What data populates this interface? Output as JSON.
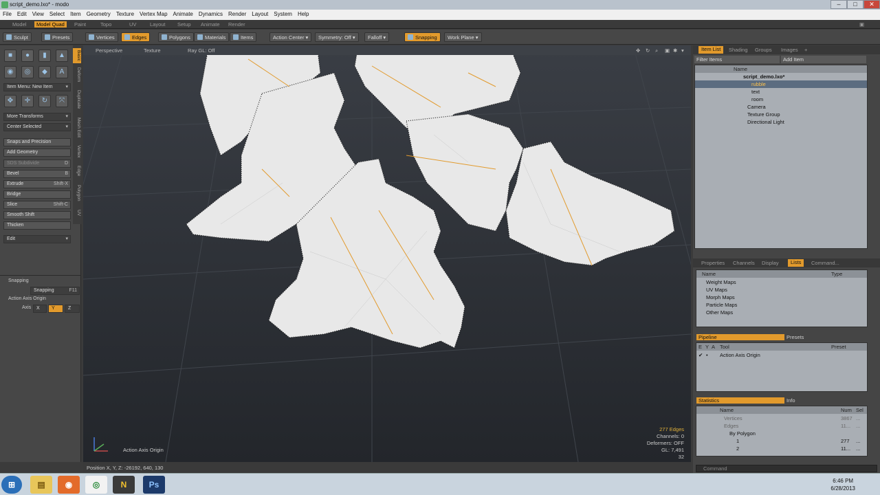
{
  "window": {
    "title": "script_demo.lxo* - modo",
    "minimize": "–",
    "maximize": "□",
    "close": "✕"
  },
  "menu": [
    "File",
    "Edit",
    "View",
    "Select",
    "Item",
    "Geometry",
    "Texture",
    "Vertex Map",
    "Animate",
    "Dynamics",
    "Render",
    "Layout",
    "System",
    "Help"
  ],
  "layouts": [
    "Model",
    "Model Quad",
    "Paint",
    "Topo",
    "UV",
    "Layout",
    "Setup",
    "Animate",
    "Render"
  ],
  "layouts_active": "Model Quad",
  "toolbar": {
    "sculpt": "Sculpt",
    "presets": "Presets",
    "vertices": "Vertices",
    "edges": "Edges",
    "polygons": "Polygons",
    "materials": "Materials",
    "items": "Items",
    "action_center": "Action Center",
    "symmetry": "Symmetry: Off",
    "falloff": "Falloff",
    "snapping": "Snapping",
    "work_plane": "Work Plane"
  },
  "left": {
    "vtabs": [
      "Basic",
      "Deform",
      "Duplicate",
      "Mesh Edit",
      "Vertex",
      "Edge",
      "Polygon",
      "UV"
    ],
    "item_menu": "Item Menu: New Item",
    "more_transforms": "More Transforms",
    "center_selected": "Center Selected",
    "snaps_precision": "Snaps and Precision",
    "add_geometry": "Add Geometry",
    "tools": [
      {
        "label": "SDS Subdivide",
        "key": "D",
        "disabled": true
      },
      {
        "label": "Bevel",
        "key": "B",
        "disabled": false
      },
      {
        "label": "Extrude",
        "key": "Shift-X",
        "disabled": false
      },
      {
        "label": "Bridge",
        "key": "",
        "disabled": false
      },
      {
        "label": "Slice",
        "key": "Shift-C",
        "disabled": false
      },
      {
        "label": "Smooth Shift",
        "key": "",
        "disabled": false
      },
      {
        "label": "Thicken",
        "key": "",
        "disabled": false
      }
    ],
    "edit": "Edit",
    "snapping_title": "Snapping",
    "snapping_field": "Snapping",
    "snapping_key": "F11",
    "action_axis_origin": "Action Axis Origin",
    "axis_label": "Axis",
    "axis": [
      "X",
      "Y",
      "Z"
    ]
  },
  "viewport": {
    "perspective": "Perspective",
    "texture": "Texture",
    "ray_gl": "Ray GL: Off",
    "axis_label": "Action Axis Origin",
    "info": [
      "277 Edges",
      "Channels: 0",
      "Deformers: OFF",
      "GL: 7,491",
      "32"
    ]
  },
  "status": {
    "position": "Position X, Y, Z:   -26192, 640, 130",
    "command_placeholder": "Command"
  },
  "right": {
    "top_tabs": [
      "Item List",
      "Shading",
      "Groups",
      "Images",
      "+"
    ],
    "filter": "Filter Items",
    "add_item": "Add Item",
    "name_col": "Name",
    "items": [
      {
        "label": "script_demo.lxo*",
        "indent": 0,
        "sel": false,
        "bold": true
      },
      {
        "label": "rubble",
        "indent": 2,
        "sel": true,
        "bold": false
      },
      {
        "label": "text",
        "indent": 2,
        "sel": false,
        "bold": false
      },
      {
        "label": "room",
        "indent": 2,
        "sel": false,
        "bold": false
      },
      {
        "label": "Camera",
        "indent": 1,
        "sel": false,
        "bold": false
      },
      {
        "label": "Texture Group",
        "indent": 1,
        "sel": false,
        "bold": false
      },
      {
        "label": "Directional Light",
        "indent": 1,
        "sel": false,
        "bold": false
      }
    ],
    "mid_tabs": [
      "Properties",
      "Channels",
      "Display",
      "Lists",
      "Command..."
    ],
    "lists_cols": [
      "Name",
      "Type"
    ],
    "lists": [
      "Weight Maps",
      "UV Maps",
      "Morph Maps",
      "Particle Maps",
      "Other Maps"
    ],
    "pipeline": "Pipeline",
    "presets": "Presets",
    "pipe_cols": [
      "E",
      "Y",
      "A",
      "Tool",
      "Preset"
    ],
    "pipe_row": "Action Axis Origin",
    "statistics": "Statistics",
    "info": "Info",
    "stat_cols": [
      "Name",
      "Num",
      "Sel"
    ],
    "stats": [
      {
        "name": "Vertices",
        "num": "3867",
        "sel": "...",
        "indent": 1
      },
      {
        "name": "Edges",
        "num": "11...",
        "sel": "...",
        "indent": 1
      },
      {
        "name": "By Polygon",
        "num": "",
        "sel": "",
        "indent": 2
      },
      {
        "name": "1",
        "num": "277",
        "sel": "...",
        "indent": 3
      },
      {
        "name": "2",
        "num": "11...",
        "sel": "...",
        "indent": 3
      }
    ]
  },
  "taskbar": {
    "time": "6:46 PM",
    "date": "6/28/2013",
    "apps": [
      "explorer",
      "firefox",
      "chrome",
      "norton",
      "photoshop"
    ],
    "ps_label": "Ps"
  }
}
